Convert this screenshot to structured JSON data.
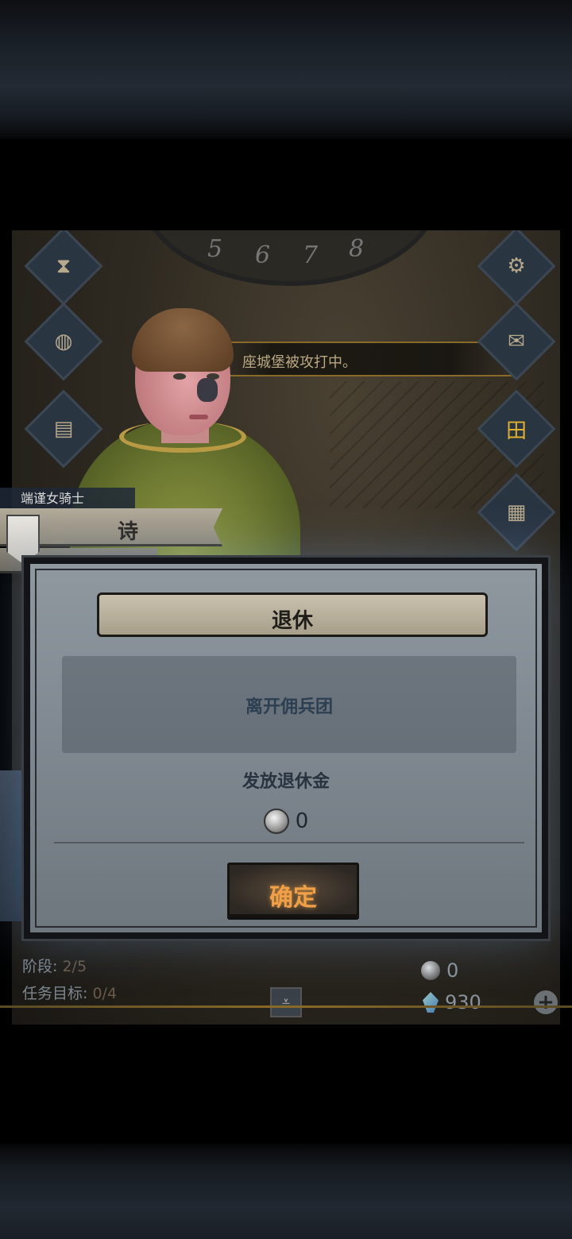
{
  "map": {
    "dial_numbers": [
      "5",
      "6",
      "7",
      "8"
    ],
    "banner_text": "座城堡被攻打中。"
  },
  "hero": {
    "class": "端谨女骑士",
    "name": "诗"
  },
  "modal": {
    "title": "退休",
    "description": "离开佣兵团",
    "pension_label": "发放退休金",
    "pension_amount": "0",
    "confirm_label": "确定"
  },
  "quest": {
    "stage_label": "阶段:",
    "stage_value": "2/5",
    "target_label": "任务目标:",
    "target_value": "0/4"
  },
  "resources": {
    "coins": "0",
    "gems": "930"
  },
  "colors": {
    "accent_gold": "#f0a048",
    "modal_bg": "#828b93"
  }
}
